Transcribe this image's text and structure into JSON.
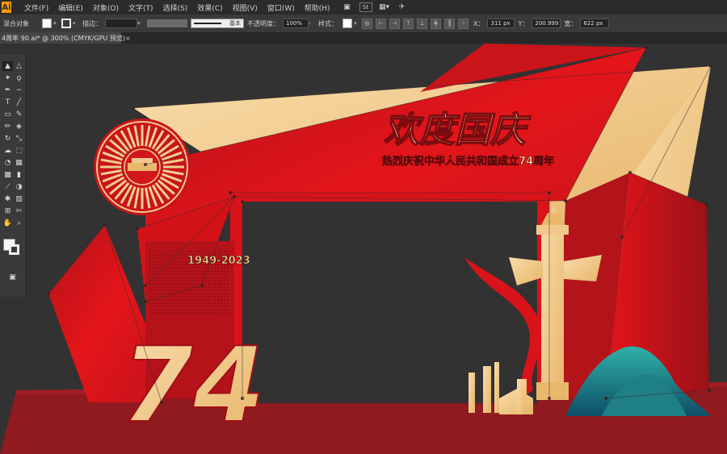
{
  "app": {
    "logo_text": "Ai"
  },
  "menubar": {
    "items": [
      "文件(F)",
      "编辑(E)",
      "对象(O)",
      "文字(T)",
      "选择(S)",
      "效果(C)",
      "视图(V)",
      "窗口(W)",
      "帮助(H)"
    ],
    "bridge_label": "St"
  },
  "controlbar": {
    "selection_label": "混合对象",
    "stroke_label": "描边：",
    "stroke_weight": "",
    "brush_label": "基本",
    "opacity_label": "不透明度：",
    "opacity_value": "100%",
    "style_label": "样式：",
    "x_value": "311 px",
    "y_value": "200.999",
    "width_label": "宽：",
    "width_value": "622 px"
  },
  "document_tab": {
    "title": "4周年 90.ai* @ 300% (CMYK/GPU 预览)",
    "close_glyph": "×"
  },
  "artwork": {
    "headline": "欢度国庆",
    "subline": "热烈庆祝中华人民共和国成立74周年",
    "number": "74",
    "small_text": "1949-2023",
    "colors": {
      "red": "#e3151a",
      "dark_red": "#a8171c",
      "floor": "#8f1a1f",
      "cream": "#f4cf8f",
      "gold": "#e9b86d",
      "teal": "#1d8c8a",
      "canvas_bg": "#323232"
    }
  },
  "tools": [
    {
      "icon": "selection-tool-icon",
      "glyph": "▲"
    },
    {
      "icon": "direct-selection-tool-icon",
      "glyph": "△"
    },
    {
      "icon": "magic-wand-icon",
      "glyph": "✦"
    },
    {
      "icon": "lasso-icon",
      "glyph": "ϙ"
    },
    {
      "icon": "pen-tool-icon",
      "glyph": "✒"
    },
    {
      "icon": "curvature-tool-icon",
      "glyph": "∽"
    },
    {
      "icon": "type-tool-icon",
      "glyph": "T"
    },
    {
      "icon": "line-tool-icon",
      "glyph": "╱"
    },
    {
      "icon": "rectangle-tool-icon",
      "glyph": "▭"
    },
    {
      "icon": "paintbrush-icon",
      "glyph": "✎"
    },
    {
      "icon": "pencil-icon",
      "glyph": "✏"
    },
    {
      "icon": "eraser-icon",
      "glyph": "◈"
    },
    {
      "icon": "rotate-tool-icon",
      "glyph": "↻"
    },
    {
      "icon": "scale-tool-icon",
      "glyph": "⤡"
    },
    {
      "icon": "warp-tool-icon",
      "glyph": "☁"
    },
    {
      "icon": "free-transform-icon",
      "glyph": "⬚"
    },
    {
      "icon": "shape-builder-icon",
      "glyph": "◔"
    },
    {
      "icon": "perspective-grid-icon",
      "glyph": "▦"
    },
    {
      "icon": "mesh-tool-icon",
      "glyph": "▩"
    },
    {
      "icon": "gradient-tool-icon",
      "glyph": "▮"
    },
    {
      "icon": "eyedropper-icon",
      "glyph": "⟋"
    },
    {
      "icon": "blend-tool-icon",
      "glyph": "◑"
    },
    {
      "icon": "symbol-sprayer-icon",
      "glyph": "✱"
    },
    {
      "icon": "graph-tool-icon",
      "glyph": "▥"
    },
    {
      "icon": "artboard-tool-icon",
      "glyph": "⊞"
    },
    {
      "icon": "slice-tool-icon",
      "glyph": "✂"
    },
    {
      "icon": "hand-tool-icon",
      "glyph": "✋"
    },
    {
      "icon": "zoom-tool-icon",
      "glyph": "⌕"
    }
  ]
}
